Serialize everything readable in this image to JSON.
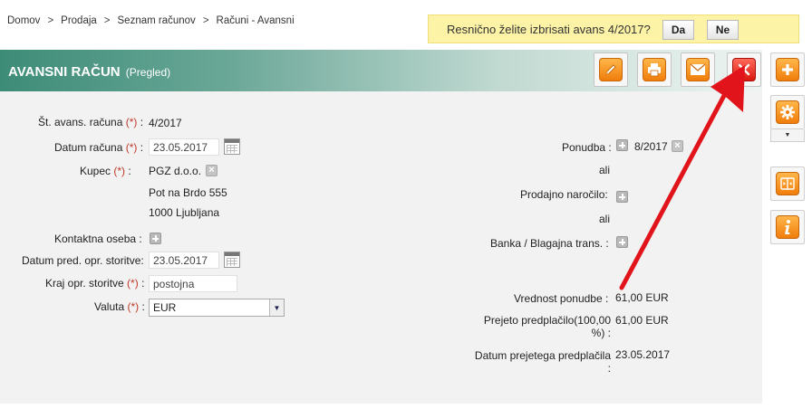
{
  "breadcrumb": {
    "items": [
      "Domov",
      "Prodaja",
      "Seznam računov",
      "Računi - Avansni"
    ],
    "separator": ">"
  },
  "confirm": {
    "message": "Resnično želite izbrisati avans 4/2017?",
    "yes_label": "Da",
    "no_label": "Ne"
  },
  "header": {
    "title": "AVANSNI RAČUN",
    "subtitle": "(Pregled)"
  },
  "toolbar": {
    "icons": [
      "pencil-icon",
      "printer-icon",
      "envelope-icon",
      "delete-icon"
    ],
    "side_icons": [
      "plus-icon",
      "gear-icon",
      "split-icon",
      "info-icon"
    ]
  },
  "form": {
    "st_label": "Št. avans. računa",
    "st_value": "4/2017",
    "datum_label": "Datum računa",
    "datum_value": "23.05.2017",
    "kupec_label": "Kupec",
    "kupec_name": "PGZ d.o.o.",
    "kupec_street": "Pot na Brdo 555",
    "kupec_city": "1000 Ljubljana",
    "kontakt_label": "Kontaktna oseba :",
    "datum_pred_label": "Datum pred. opr. storitve:",
    "datum_pred_value": "23.05.2017",
    "kraj_label": "Kraj opr. storitve",
    "kraj_value": "postojna",
    "valuta_label": "Valuta",
    "valuta_value": "EUR",
    "required_mark": "(*)",
    "colon": ":"
  },
  "right": {
    "ponudba_label": "Ponudba :",
    "ponudba_value": "8/2017",
    "ali1": "ali",
    "narocilo_label": "Prodajno naročilo:",
    "ali2": "ali",
    "banka_label": "Banka / Blagajna trans. :",
    "vrednost_label": "Vrednost ponudbe :",
    "vrednost_value": "61,00 EUR",
    "prejeto_label_1": "Prejeto predplačilo(100,00",
    "prejeto_label_2": "%) :",
    "prejeto_value": "61,00 EUR",
    "datum_prej_label_1": "Datum prejetega predplačila",
    "datum_prej_label_2": ":",
    "datum_prej_value": "23.05.2017"
  },
  "colors": {
    "header_start": "#3d8c78",
    "confirm_bg": "#fdf3a6",
    "accent_orange": "#f07d0a",
    "accent_red": "#d9180e",
    "arrow": "#e0141a"
  }
}
